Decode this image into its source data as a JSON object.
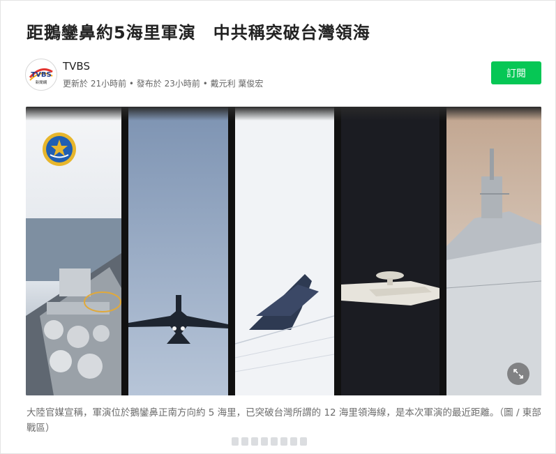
{
  "article": {
    "headline": "距鵝鑾鼻約5海里軍演　中共稱突破台灣領海",
    "caption": "大陸官媒宣稱，軍演位於鵝鑾鼻正南方向約 5 海里，已突破台灣所謂的 12 海里領海線，是本次軍演的最近距離。（圖 / 東部戰區）"
  },
  "publisher": {
    "name": "TVBS",
    "logo_text": "TVBS",
    "logo_subtext": "新聞網",
    "meta": "更新於 21小時前 • 發布於 23小時前 • 戴元利 葉俊宏",
    "subscribe_label": "訂閱"
  },
  "hero_image": {
    "panels": [
      "ship-deck",
      "fighter-jet",
      "fighter-jet-silhouette",
      "early-warning-aircraft",
      "destroyer"
    ],
    "expand_icon": "expand-icon"
  },
  "colors": {
    "subscribe_green": "#06c755",
    "caption_gray": "#6c6c6c"
  }
}
